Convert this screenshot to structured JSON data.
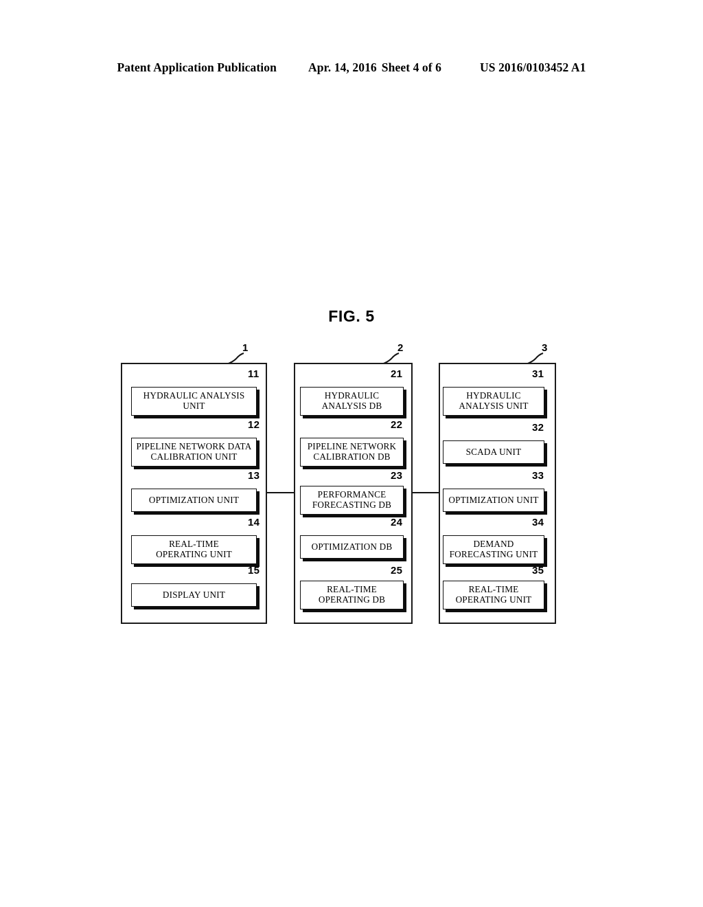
{
  "header": {
    "publication": "Patent Application Publication",
    "date": "Apr. 14, 2016",
    "sheet": "Sheet 4 of 6",
    "patent_number": "US 2016/0103452 A1"
  },
  "figure": {
    "title": "FIG. 5"
  },
  "colors": {
    "ink": "#000000",
    "background": "#ffffff",
    "shadow": "#0d0d0d"
  },
  "panels": [
    {
      "ref": "1",
      "boxes": [
        {
          "ref": "11",
          "lines": [
            "HYDRAULIC ANALYSIS",
            "UNIT"
          ]
        },
        {
          "ref": "12",
          "lines": [
            "PIPELINE NETWORK DATA",
            "CALIBRATION UNIT"
          ]
        },
        {
          "ref": "13",
          "lines": [
            "OPTIMIZATION UNIT"
          ]
        },
        {
          "ref": "14",
          "lines": [
            "REAL-TIME",
            "OPERATING UNIT"
          ]
        },
        {
          "ref": "15",
          "lines": [
            "DISPLAY UNIT"
          ]
        }
      ]
    },
    {
      "ref": "2",
      "boxes": [
        {
          "ref": "21",
          "lines": [
            "HYDRAULIC",
            "ANALYSIS DB"
          ]
        },
        {
          "ref": "22",
          "lines": [
            "PIPELINE NETWORK",
            "CALIBRATION DB"
          ]
        },
        {
          "ref": "23",
          "lines": [
            "PERFORMANCE",
            "FORECASTING DB"
          ]
        },
        {
          "ref": "24",
          "lines": [
            "OPTIMIZATION DB"
          ]
        },
        {
          "ref": "25",
          "lines": [
            "REAL-TIME",
            "OPERATING DB"
          ]
        }
      ]
    },
    {
      "ref": "3",
      "boxes": [
        {
          "ref": "31",
          "lines": [
            "HYDRAULIC",
            "ANALYSIS UNIT"
          ]
        },
        {
          "ref": "32",
          "lines": [
            "SCADA UNIT"
          ]
        },
        {
          "ref": "33",
          "lines": [
            "OPTIMIZATION UNIT"
          ]
        },
        {
          "ref": "34",
          "lines": [
            "DEMAND",
            "FORECASTING UNIT"
          ]
        },
        {
          "ref": "35",
          "lines": [
            "REAL-TIME",
            "OPERATING UNIT"
          ]
        }
      ]
    }
  ]
}
